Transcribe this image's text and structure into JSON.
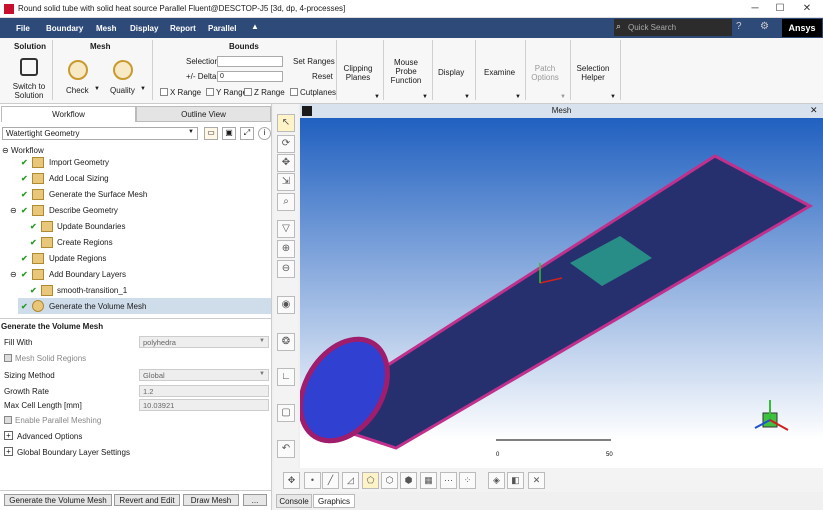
{
  "titlebar": {
    "title": "Round solid tube with solid heat source Parallel Fluent@DESCTOP-J5  [3d, dp, 4-processes]"
  },
  "menu": {
    "file": "File",
    "items": [
      "Boundary",
      "Mesh",
      "Display",
      "Report",
      "Parallel"
    ],
    "search_placeholder": "Quick Search",
    "brand": "Ansys"
  },
  "ribbon": {
    "solution_head": "Solution",
    "switch_label": "Switch to\nSolution",
    "mesh_head": "Mesh",
    "check": "Check",
    "quality": "Quality",
    "bounds_head": "Bounds",
    "selection": "Selection",
    "delta": "+/- Delta",
    "delta_val": "0",
    "set_ranges": "Set Ranges",
    "reset": "Reset",
    "xrange": "X Range",
    "yrange": "Y Range",
    "zrange": "Z Range",
    "cutplanes": "Cutplanes",
    "clipping": "Clipping\nPlanes",
    "mouse_probe": "Mouse\nProbe\nFunction",
    "display": "Display",
    "examine": "Examine",
    "patch": "Patch\nOptions",
    "selection_helper": "Selection\nHelper"
  },
  "left": {
    "tab_workflow": "Workflow",
    "tab_outline": "Outline View",
    "workflow_type": "Watertight Geometry",
    "workflow_root": "Workflow",
    "steps": [
      "Import Geometry",
      "Add Local Sizing",
      "Generate the Surface Mesh",
      "Describe Geometry",
      "Update Boundaries",
      "Create Regions",
      "Update Regions",
      "Add Boundary Layers",
      "smooth-transition_1",
      "Generate the Volume Mesh"
    ],
    "section": "Generate the Volume Mesh",
    "fill_with": "Fill With",
    "fill_with_val": "polyhedra",
    "mesh_solid": "Mesh Solid Regions",
    "sizing_method": "Sizing Method",
    "sizing_method_val": "Global",
    "growth_rate": "Growth Rate",
    "growth_rate_val": "1.2",
    "max_cell": "Max Cell Length [mm]",
    "max_cell_val": "10.03921",
    "enable_parallel": "Enable Parallel Meshing",
    "adv": "Advanced Options",
    "gbl": "Global Boundary Layer Settings",
    "btn_generate": "Generate the Volume Mesh",
    "btn_revert": "Revert and Edit",
    "btn_draw": "Draw Mesh",
    "btn_more": "..."
  },
  "graphics": {
    "header": "Mesh",
    "scale_0": "0",
    "scale_50": "50",
    "tab_console": "Console",
    "tab_graphics": "Graphics"
  }
}
